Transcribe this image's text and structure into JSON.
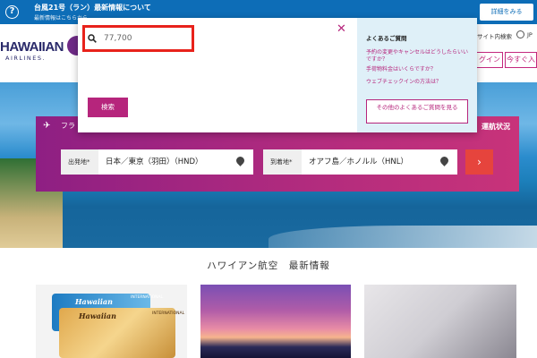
{
  "alert": {
    "icon": "question-icon",
    "title": "台風21号（ラン）最新情報について",
    "subtitle": "最新情報はこちらから",
    "button": "詳細をみる"
  },
  "header": {
    "logo_word": "HAWAIIAN",
    "logo_sub": "AIRLINES.",
    "util_link": "サイト内検索",
    "lang": "JP",
    "login": "グイン",
    "join": "今すぐ入"
  },
  "search": {
    "value": "77,700",
    "button": "検索"
  },
  "faq": {
    "title": "よくあるご質問",
    "links": [
      "予約の変更やキャンセルはどうしたらいいですか？",
      "手荷物料金はいくらですか？",
      "ウェブチェックインの方法は？"
    ],
    "more": "その他のよくあるご質問を見る"
  },
  "flight": {
    "tab": "フラ",
    "status": "運航状況",
    "from_label": "出発地*",
    "from_value": "日本／東京（羽田）（HND）",
    "to_label": "到着地*",
    "to_value": "オアフ島／ホノルル（HNL）",
    "go": "›"
  },
  "news": {
    "title": "ハワイアン航空　最新情報",
    "card_brand": "Hawaiian",
    "card_intl": "INTERNATIONAL"
  },
  "colors": {
    "accent": "#b6257c",
    "alert_bg": "#0d6db7",
    "highlight": "#e8221b",
    "go_button": "#e6443d"
  }
}
